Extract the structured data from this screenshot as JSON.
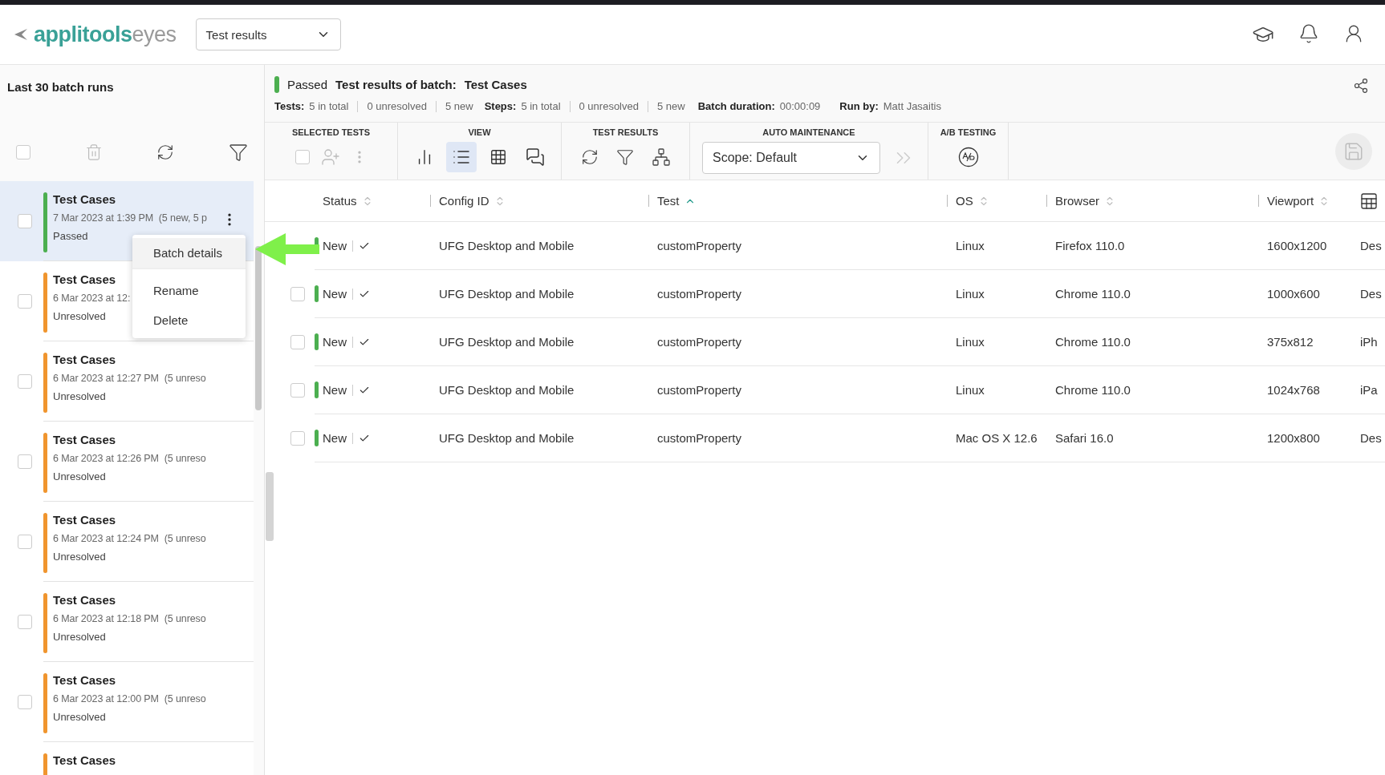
{
  "header": {
    "brand": "applitools",
    "product": "eyes",
    "page_select": "Test results"
  },
  "sidebar": {
    "title": "Last 30 batch runs",
    "select_all_checked": false,
    "batches": [
      {
        "title": "Test Cases",
        "date": "7 Mar 2023 at 1:39 PM  (5 new, 5 p",
        "status": "Passed",
        "kind": "passed",
        "selected": true,
        "checked": false
      },
      {
        "title": "Test Cases",
        "date": "6 Mar 2023 at 12:",
        "status": "Unresolved",
        "kind": "unresolved",
        "selected": false,
        "checked": false
      },
      {
        "title": "Test Cases",
        "date": "6 Mar 2023 at 12:27 PM  (5 unreso",
        "status": "Unresolved",
        "kind": "unresolved",
        "selected": false,
        "checked": false
      },
      {
        "title": "Test Cases",
        "date": "6 Mar 2023 at 12:26 PM  (5 unreso",
        "status": "Unresolved",
        "kind": "unresolved",
        "selected": false,
        "checked": false
      },
      {
        "title": "Test Cases",
        "date": "6 Mar 2023 at 12:24 PM  (5 unreso",
        "status": "Unresolved",
        "kind": "unresolved",
        "selected": false,
        "checked": false
      },
      {
        "title": "Test Cases",
        "date": "6 Mar 2023 at 12:18 PM  (5 unreso",
        "status": "Unresolved",
        "kind": "unresolved",
        "selected": false,
        "checked": false
      },
      {
        "title": "Test Cases",
        "date": "6 Mar 2023 at 12:00 PM  (5 unreso",
        "status": "Unresolved",
        "kind": "unresolved",
        "selected": false,
        "checked": false
      },
      {
        "title": "Test Cases",
        "kind": "unresolved",
        "selected": false
      }
    ]
  },
  "context_menu": {
    "items": [
      {
        "label": "Batch details",
        "highlighted": true
      },
      {
        "label": "Rename",
        "highlighted": false
      },
      {
        "label": "Delete",
        "highlighted": false
      }
    ]
  },
  "batch_header": {
    "status": "Passed",
    "title_label": "Test results of batch:",
    "title": "Test Cases",
    "stats": [
      {
        "label": "Tests:",
        "values": [
          "5 in total",
          "0 unresolved",
          "5 new"
        ]
      },
      {
        "label": "Steps:",
        "values": [
          "5 in total",
          "0 unresolved",
          "5 new"
        ]
      }
    ],
    "duration_label": "Batch duration:",
    "duration": "00:00:09",
    "run_by_label": "Run by:",
    "run_by": "Matt Jasaitis"
  },
  "toolbar": {
    "selected_tests": "SELECTED TESTS",
    "view": "VIEW",
    "test_results": "TEST RESULTS",
    "auto_maintenance": "AUTO MAINTENANCE",
    "ab_testing": "A/B TESTING",
    "view_buttons": [
      {
        "kind": "chart",
        "selected": false
      },
      {
        "kind": "list",
        "selected": true
      },
      {
        "kind": "grid",
        "selected": false
      },
      {
        "kind": "comments",
        "selected": false
      }
    ],
    "scope": "Scope: Default",
    "select_checked": false
  },
  "table": {
    "columns": [
      {
        "label": "Status",
        "sorted": false
      },
      {
        "label": "Config ID",
        "sorted": false
      },
      {
        "label": "Test",
        "sorted": true
      },
      {
        "label": "OS",
        "sorted": false
      },
      {
        "label": "Browser",
        "sorted": false
      },
      {
        "label": "Viewport",
        "sorted": false
      }
    ],
    "rows": [
      {
        "status": "New",
        "config": "UFG Desktop and Mobile",
        "test": "customProperty",
        "os": "Linux",
        "browser": "Firefox 110.0",
        "viewport": "1600x1200",
        "column_7": "Des"
      },
      {
        "status": "New",
        "config": "UFG Desktop and Mobile",
        "test": "customProperty",
        "os": "Linux",
        "browser": "Chrome 110.0",
        "viewport": "1000x600",
        "column_7": "Des",
        "checked": false
      },
      {
        "status": "New",
        "config": "UFG Desktop and Mobile",
        "test": "customProperty",
        "os": "Linux",
        "browser": "Chrome 110.0",
        "viewport": "375x812",
        "column_7": "iPh",
        "checked": false
      },
      {
        "status": "New",
        "config": "UFG Desktop and Mobile",
        "test": "customProperty",
        "os": "Linux",
        "browser": "Chrome 110.0",
        "viewport": "1024x768",
        "column_7": "iPa",
        "checked": false
      },
      {
        "status": "New",
        "config": "UFG Desktop and Mobile",
        "test": "customProperty",
        "os": "Mac OS X 12.6",
        "browser": "Safari 16.0",
        "viewport": "1200x800",
        "column_7": "Des",
        "checked": false
      }
    ]
  }
}
